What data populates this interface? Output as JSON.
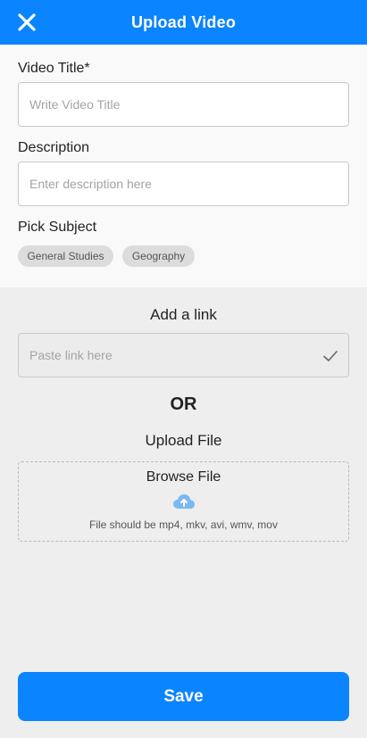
{
  "header": {
    "title": "Upload Video",
    "close_icon": "close-icon"
  },
  "form": {
    "video_title": {
      "label": "Video Title*",
      "placeholder": "Write Video Title",
      "value": ""
    },
    "description": {
      "label": "Description",
      "placeholder": "Enter description here",
      "value": ""
    },
    "subject": {
      "label": "Pick Subject",
      "chips": [
        "General Studies",
        "Geography"
      ]
    }
  },
  "link": {
    "title": "Add a link",
    "placeholder": "Paste link here",
    "check_icon": "check-icon"
  },
  "or_text": "OR",
  "upload": {
    "title": "Upload File",
    "browse_label": "Browse File",
    "cloud_icon": "cloud-upload-icon",
    "hint": "File should be mp4, mkv, avi, wmv, mov"
  },
  "save_label": "Save",
  "colors": {
    "accent": "#0a84ff",
    "chip_bg": "#dcdcdc",
    "page_bg": "#eeeeee"
  }
}
